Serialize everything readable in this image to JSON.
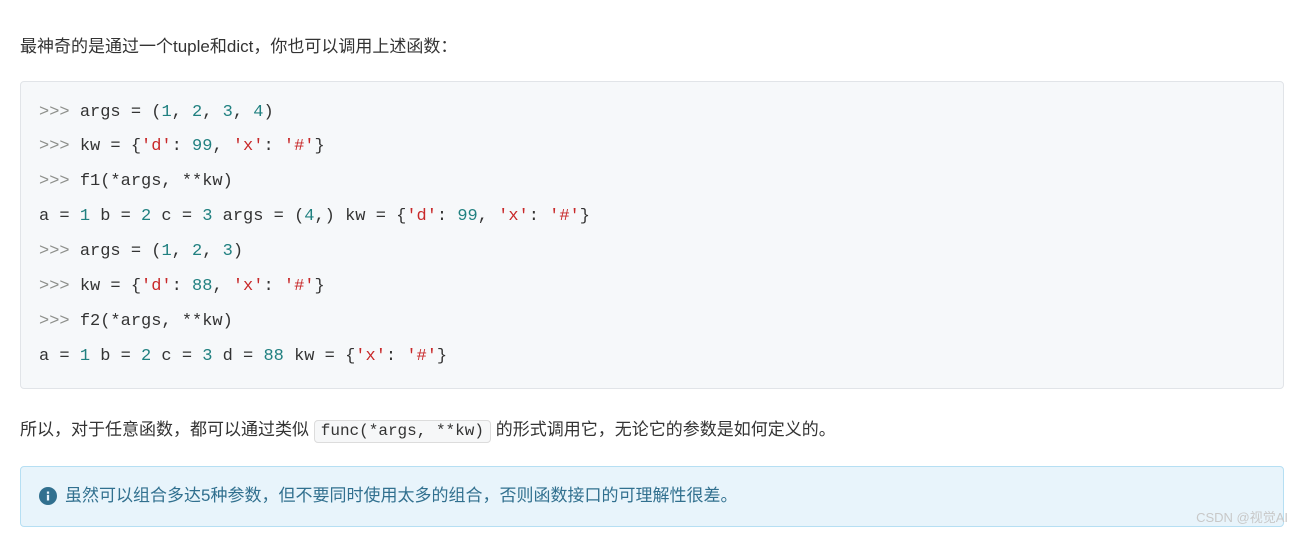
{
  "intro": "最神奇的是通过一个tuple和dict，你也可以调用上述函数：",
  "code": {
    "lines": [
      {
        "type": "cmd",
        "tokens": [
          {
            "t": "prompt",
            "v": ">>> "
          },
          {
            "t": "plain",
            "v": "args = ("
          },
          {
            "t": "num",
            "v": "1"
          },
          {
            "t": "plain",
            "v": ", "
          },
          {
            "t": "num",
            "v": "2"
          },
          {
            "t": "plain",
            "v": ", "
          },
          {
            "t": "num",
            "v": "3"
          },
          {
            "t": "plain",
            "v": ", "
          },
          {
            "t": "num",
            "v": "4"
          },
          {
            "t": "plain",
            "v": ")"
          }
        ]
      },
      {
        "type": "cmd",
        "tokens": [
          {
            "t": "prompt",
            "v": ">>> "
          },
          {
            "t": "plain",
            "v": "kw = {"
          },
          {
            "t": "str",
            "v": "'d'"
          },
          {
            "t": "plain",
            "v": ": "
          },
          {
            "t": "num",
            "v": "99"
          },
          {
            "t": "plain",
            "v": ", "
          },
          {
            "t": "str",
            "v": "'x'"
          },
          {
            "t": "plain",
            "v": ": "
          },
          {
            "t": "str",
            "v": "'#'"
          },
          {
            "t": "plain",
            "v": "}"
          }
        ]
      },
      {
        "type": "cmd",
        "tokens": [
          {
            "t": "prompt",
            "v": ">>> "
          },
          {
            "t": "plain",
            "v": "f1(*args, **kw)"
          }
        ]
      },
      {
        "type": "out",
        "tokens": [
          {
            "t": "plain",
            "v": "a = "
          },
          {
            "t": "num",
            "v": "1"
          },
          {
            "t": "plain",
            "v": " b = "
          },
          {
            "t": "num",
            "v": "2"
          },
          {
            "t": "plain",
            "v": " c = "
          },
          {
            "t": "num",
            "v": "3"
          },
          {
            "t": "plain",
            "v": " args = ("
          },
          {
            "t": "num",
            "v": "4"
          },
          {
            "t": "plain",
            "v": ",) kw = {"
          },
          {
            "t": "str",
            "v": "'d'"
          },
          {
            "t": "plain",
            "v": ": "
          },
          {
            "t": "num",
            "v": "99"
          },
          {
            "t": "plain",
            "v": ", "
          },
          {
            "t": "str",
            "v": "'x'"
          },
          {
            "t": "plain",
            "v": ": "
          },
          {
            "t": "str",
            "v": "'#'"
          },
          {
            "t": "plain",
            "v": "}"
          }
        ]
      },
      {
        "type": "cmd",
        "tokens": [
          {
            "t": "prompt",
            "v": ">>> "
          },
          {
            "t": "plain",
            "v": "args = ("
          },
          {
            "t": "num",
            "v": "1"
          },
          {
            "t": "plain",
            "v": ", "
          },
          {
            "t": "num",
            "v": "2"
          },
          {
            "t": "plain",
            "v": ", "
          },
          {
            "t": "num",
            "v": "3"
          },
          {
            "t": "plain",
            "v": ")"
          }
        ]
      },
      {
        "type": "cmd",
        "tokens": [
          {
            "t": "prompt",
            "v": ">>> "
          },
          {
            "t": "plain",
            "v": "kw = {"
          },
          {
            "t": "str",
            "v": "'d'"
          },
          {
            "t": "plain",
            "v": ": "
          },
          {
            "t": "num",
            "v": "88"
          },
          {
            "t": "plain",
            "v": ", "
          },
          {
            "t": "str",
            "v": "'x'"
          },
          {
            "t": "plain",
            "v": ": "
          },
          {
            "t": "str",
            "v": "'#'"
          },
          {
            "t": "plain",
            "v": "}"
          }
        ]
      },
      {
        "type": "cmd",
        "tokens": [
          {
            "t": "prompt",
            "v": ">>> "
          },
          {
            "t": "plain",
            "v": "f2(*args, **kw)"
          }
        ]
      },
      {
        "type": "out",
        "tokens": [
          {
            "t": "plain",
            "v": "a = "
          },
          {
            "t": "num",
            "v": "1"
          },
          {
            "t": "plain",
            "v": " b = "
          },
          {
            "t": "num",
            "v": "2"
          },
          {
            "t": "plain",
            "v": " c = "
          },
          {
            "t": "num",
            "v": "3"
          },
          {
            "t": "plain",
            "v": " d = "
          },
          {
            "t": "num",
            "v": "88"
          },
          {
            "t": "plain",
            "v": " kw = {"
          },
          {
            "t": "str",
            "v": "'x'"
          },
          {
            "t": "plain",
            "v": ": "
          },
          {
            "t": "str",
            "v": "'#'"
          },
          {
            "t": "plain",
            "v": "}"
          }
        ]
      }
    ]
  },
  "conclusion": {
    "before": "所以，对于任意函数，都可以通过类似 ",
    "code": "func(*args, **kw)",
    "after": " 的形式调用它，无论它的参数是如何定义的。"
  },
  "alert": {
    "icon_name": "info-icon",
    "text": "虽然可以组合多达5种参数，但不要同时使用太多的组合，否则函数接口的可理解性很差。"
  },
  "watermark": "CSDN @视觉AI"
}
